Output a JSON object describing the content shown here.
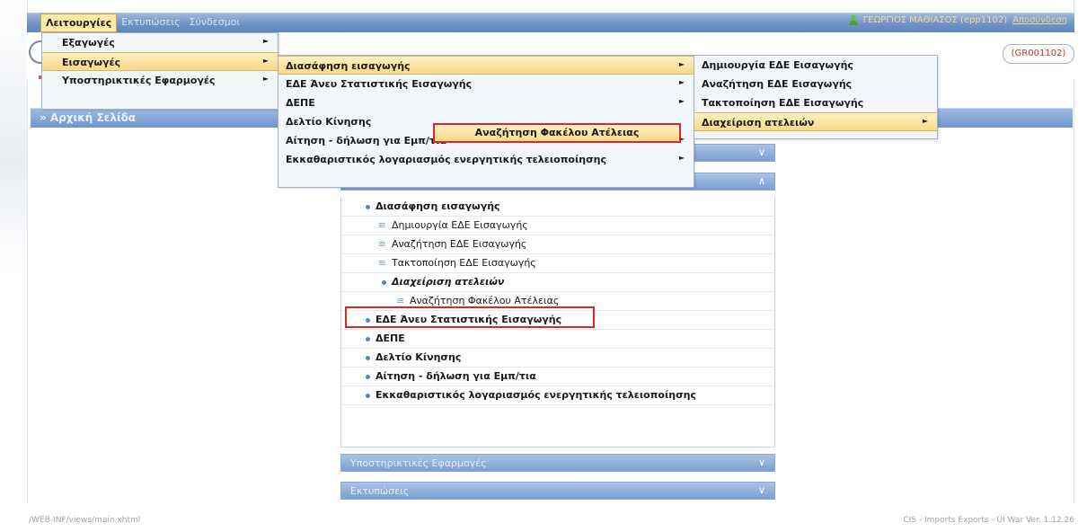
{
  "menubar": {
    "items": [
      "Λειτουργίες",
      "Εκτυπώσεις",
      "Σύνδεσμοι"
    ],
    "user": "ΓΕΩΡΓΙΟΣ ΜΑΘΙΑΣΟΣ (epp1102)",
    "logout": "Αποσύνδεση"
  },
  "office": "(GR001102)",
  "breadcrumb": "» Αρχική Σελίδα",
  "menu1": {
    "items": [
      {
        "label": "Εξαγωγές"
      },
      {
        "label": "Εισαγωγές"
      },
      {
        "label": "Υποστηρικτικές Εφαρμογές"
      }
    ]
  },
  "menu2": {
    "items": [
      {
        "label": "Διασάφηση εισαγωγής"
      },
      {
        "label": "ΕΔΕ Άνευ Στατιστικής Εισαγωγής"
      },
      {
        "label": "ΔΕΠΕ"
      },
      {
        "label": "Δελτίο Κίνησης"
      },
      {
        "label": "Αίτηση - δήλωση για Εμπ/τια"
      },
      {
        "label": "Εκκαθαριστικός λογαριασμός ενεργητικής τελειοποίησης"
      }
    ]
  },
  "menu3": {
    "items": [
      {
        "label": "Δημιουργία ΕΔΕ Εισαγωγής"
      },
      {
        "label": "Αναζήτηση ΕΔΕ Εισαγωγής"
      },
      {
        "label": "Τακτοποίηση ΕΔΕ Εισαγωγής"
      },
      {
        "label": "Διαχείριση ατελειών"
      }
    ]
  },
  "popup": "Αναζήτηση Φακέλου Ατέλειας",
  "panel": {
    "list": [
      {
        "label": "Διασάφηση εισαγωγής"
      },
      {
        "label": "Δημιουργία ΕΔΕ Εισαγωγής"
      },
      {
        "label": "Αναζήτηση ΕΔΕ Εισαγωγής"
      },
      {
        "label": "Τακτοποίηση ΕΔΕ Εισαγωγής"
      },
      {
        "label": "Διαχείριση ατελειών"
      },
      {
        "label": "Αναζήτηση Φακέλου Ατέλειας"
      },
      {
        "label": "ΕΔΕ Άνευ Στατιστικής Εισαγωγής"
      },
      {
        "label": "ΔΕΠΕ"
      },
      {
        "label": "Δελτίο Κίνησης"
      },
      {
        "label": "Αίτηση - δήλωση για Εμπ/τια"
      },
      {
        "label": "Εκκαθαριστικός λογαριασμός ενεργητικής τελειοποίησης"
      }
    ],
    "section_support": "Υποστηρικτικές Εφαρμογές",
    "section_prints": "Εκτυπώσεις"
  },
  "footer": {
    "left": "/WEB-INF/views/main.xhtml",
    "right": "CIS - Imports Exports - UI War Ver. 1.12.26"
  }
}
